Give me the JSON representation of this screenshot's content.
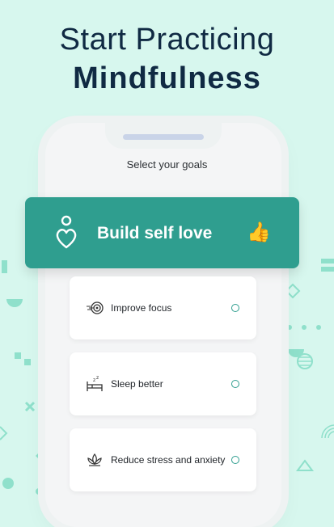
{
  "headline": {
    "line1": "Start Practicing",
    "line2": "Mindfulness"
  },
  "screen": {
    "title": "Select your goals"
  },
  "hero": {
    "label": "Build self love",
    "icon": "heart-person-icon",
    "thumb": "👍"
  },
  "goals": [
    {
      "label": "Improve focus",
      "icon": "focus-target-icon"
    },
    {
      "label": "Sleep better",
      "icon": "sleep-bed-icon"
    },
    {
      "label": "Reduce stress and anxiety",
      "icon": "lotus-icon"
    }
  ],
  "colors": {
    "background": "#d7f7ee",
    "accent": "#2f9e8f",
    "headline": "#102a43",
    "deco": "#7ed9c2"
  }
}
